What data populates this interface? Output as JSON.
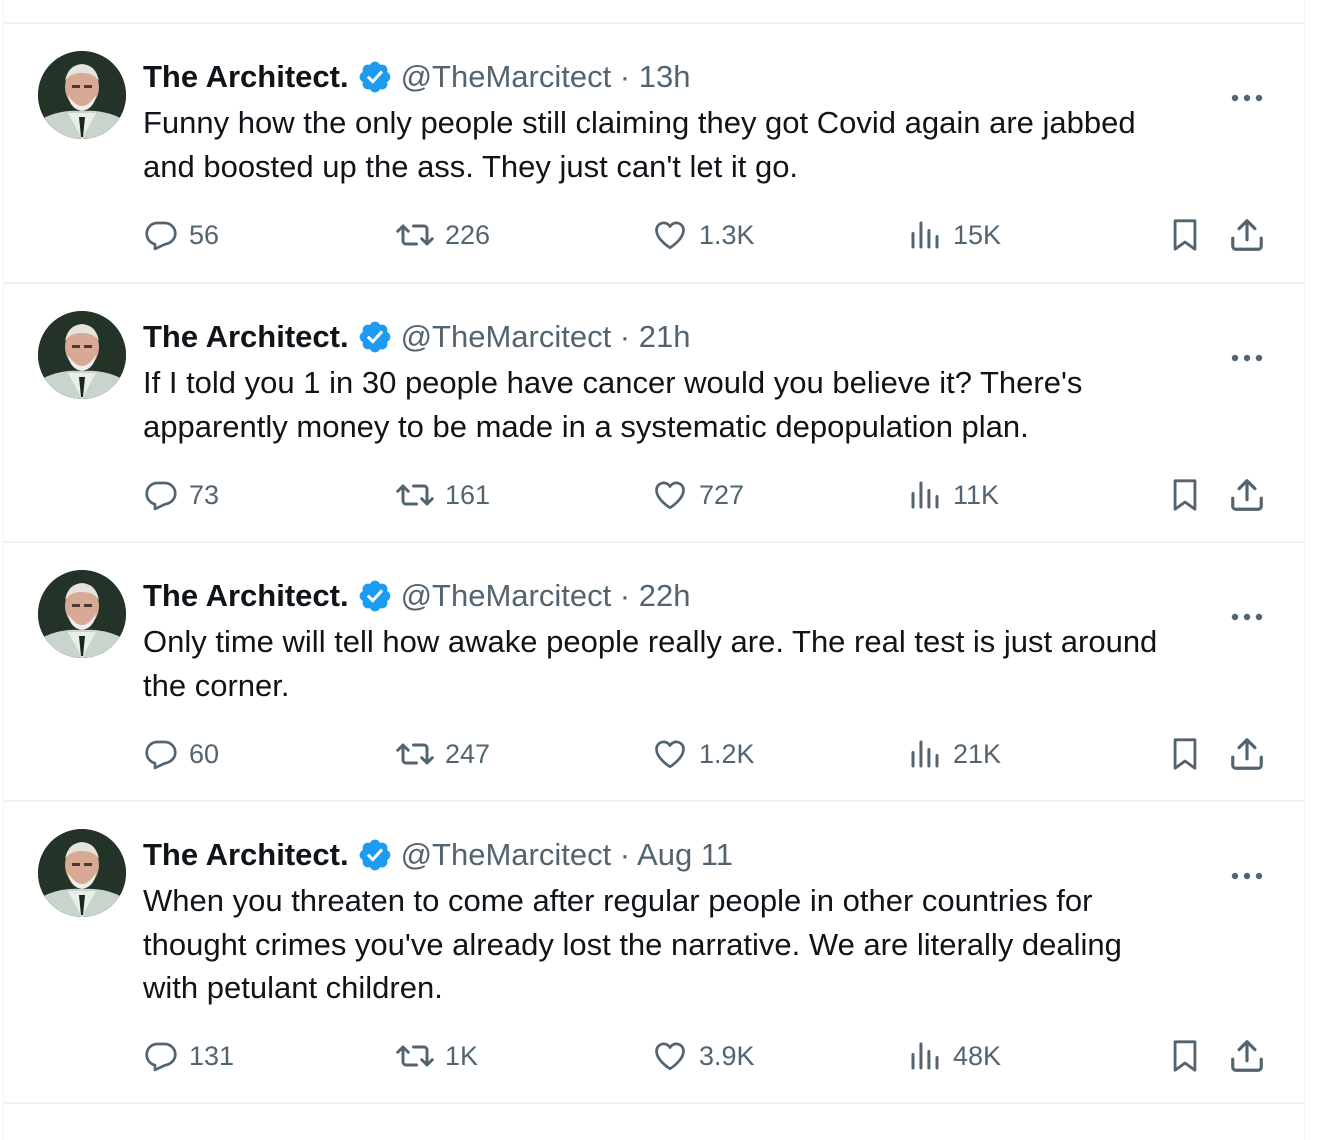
{
  "colors": {
    "text": "#0f1419",
    "secondary": "#536471",
    "verified": "#1d9bf0",
    "divider": "#eff3f4"
  },
  "icons": {
    "verified": "verified-badge-icon",
    "more": "more-options-icon",
    "reply": "reply-icon",
    "retweet": "retweet-icon",
    "like": "heart-icon",
    "views": "views-icon",
    "bookmark": "bookmark-icon",
    "share": "share-icon"
  },
  "tweets": [
    {
      "name": "The Architect.",
      "handle_time": "@TheMarcitect · 13h",
      "text": "Funny how the only people still claiming they got Covid again are jabbed\nand boosted up the ass. They just can't let it go.",
      "replies": "56",
      "retweets": "226",
      "likes": "1.3K",
      "views": "15K"
    },
    {
      "name": "The Architect.",
      "handle_time": "@TheMarcitect · 21h",
      "text": "If I told you 1 in 30 people have cancer would you believe it? There's\napparently money to be made in a systematic depopulation plan.",
      "replies": "73",
      "retweets": "161",
      "likes": "727",
      "views": "11K"
    },
    {
      "name": "The Architect.",
      "handle_time": "@TheMarcitect · 22h",
      "text": "Only time will tell how awake people really are. The real test is just around\nthe corner.",
      "replies": "60",
      "retweets": "247",
      "likes": "1.2K",
      "views": "21K"
    },
    {
      "name": "The Architect.",
      "handle_time": "@TheMarcitect · Aug 11",
      "text": "When you threaten to come after regular people in other countries for\nthought crimes you've already lost the narrative. We are literally dealing\nwith petulant children.",
      "replies": "131",
      "retweets": "1K",
      "likes": "3.9K",
      "views": "48K"
    }
  ]
}
